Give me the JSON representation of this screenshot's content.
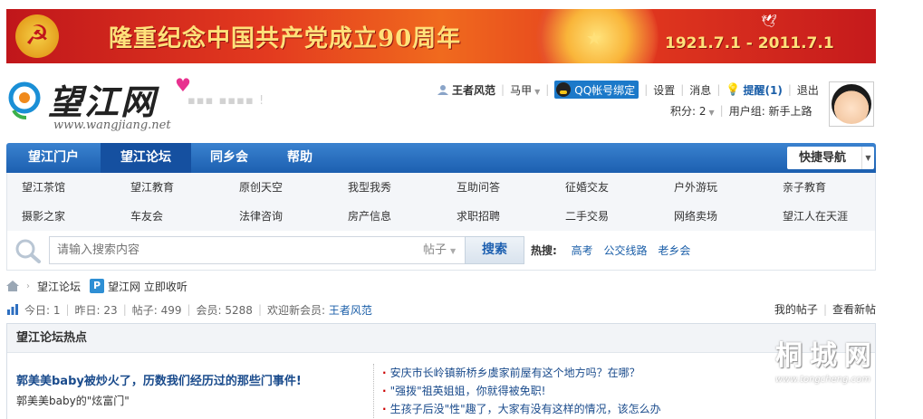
{
  "banner": {
    "title": "隆重纪念中国共产党成立90周年",
    "dates": "1921.7.1 - 2011.7.1"
  },
  "logo": {
    "name": "望江网",
    "url": "www.wangjiang.net"
  },
  "user": {
    "username": "王者风范",
    "vest": "马甲",
    "qq_bind": "QQ帐号绑定",
    "settings": "设置",
    "messages": "消息",
    "notice": "提醒(1)",
    "logout": "退出",
    "points": "积分: 2",
    "group": "用户组: 新手上路"
  },
  "nav": {
    "items": [
      "望江门户",
      "望江论坛",
      "同乡会",
      "帮助"
    ],
    "active": "望江论坛",
    "quick_nav": "快捷导航"
  },
  "subnav": [
    [
      "望江茶馆",
      "望江教育",
      "原创天空",
      "我型我秀",
      "互助问答",
      "征婚交友",
      "户外游玩",
      "亲子教育"
    ],
    [
      "摄影之家",
      "车友会",
      "法律咨询",
      "房产信息",
      "求职招聘",
      "二手交易",
      "网络卖场",
      "望江人在天涯"
    ]
  ],
  "search": {
    "placeholder": "请输入搜索内容",
    "type": "帖子",
    "button": "搜索",
    "hot_label": "热搜:",
    "hot": [
      "高考",
      "公交线路",
      "老乡会"
    ]
  },
  "breadcrumb": {
    "forum": "望江论坛",
    "fav_label": "望江网 立即收听"
  },
  "stats": {
    "today": "今日: 1",
    "yesterday": "昨日: 23",
    "posts": "帖子: 499",
    "members": "会员: 5288",
    "welcome": "欢迎新会员:",
    "new_member": "王者风范",
    "my_posts": "我的帖子",
    "new_posts": "查看新帖"
  },
  "hot_panel": {
    "title": "望江论坛热点",
    "lead": "郭美美baby被炒火了，历数我们经历过的那些门事件!",
    "desc": "郭美美baby的\"炫富门\"",
    "links": [
      "安庆市长岭镇新桥乡虞家前屋有这个地方吗？在哪？",
      "\"强拨\"祖英姐姐，你就得被免职!",
      "生孩子后没\"性\"趣了，大家有没有这样的情况，该怎么办"
    ]
  },
  "watermark": {
    "name": "桐城网",
    "url": "www.tongcheng.com"
  }
}
